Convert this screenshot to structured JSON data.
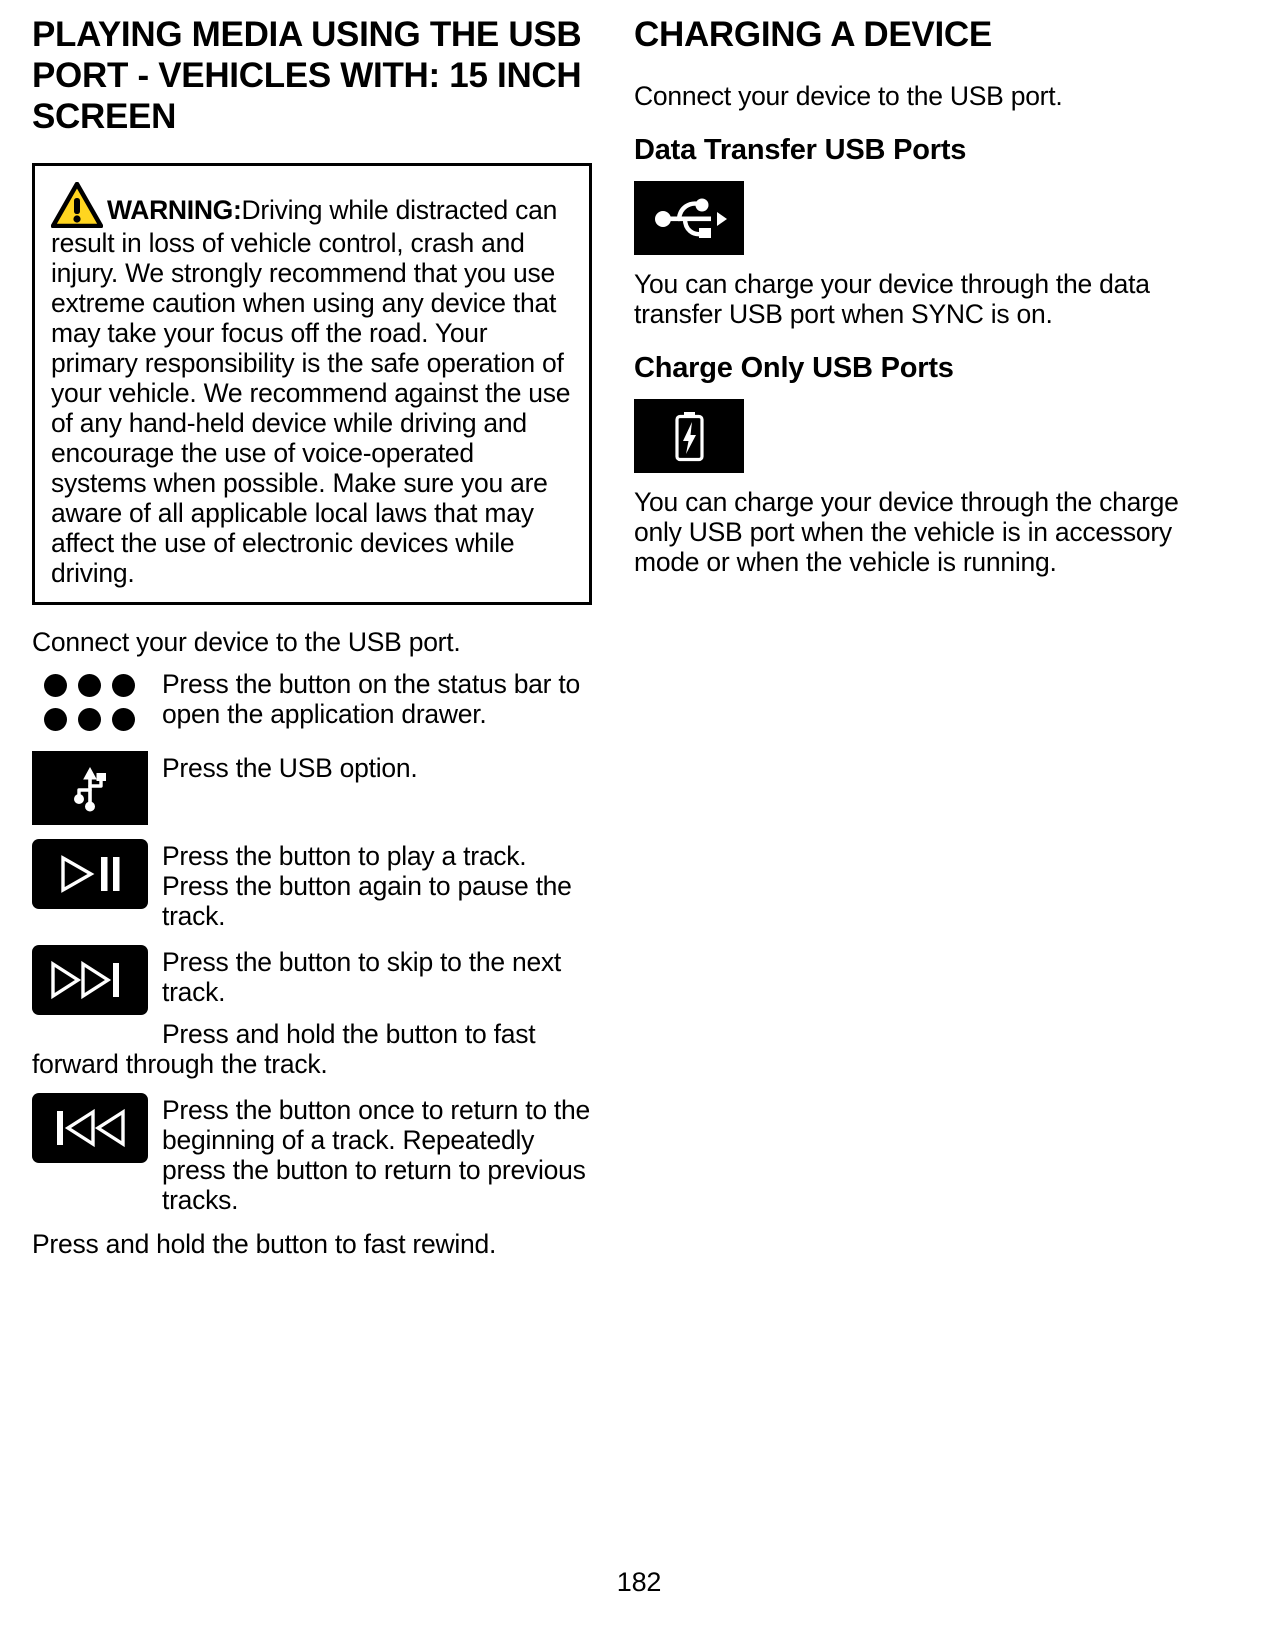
{
  "page": {
    "number": "182"
  },
  "left_column": {
    "title": "PLAYING MEDIA USING THE USB PORT - VEHICLES WITH: 15 INCH SCREEN",
    "warning": {
      "icon": "warning-triangle-icon",
      "label": "WARNING:",
      "text": "Driving while distracted can result in loss of vehicle control, crash and injury. We strongly recommend that you use extreme caution when using any device that may take your focus off the road. Your primary responsibility is the safe operation of your vehicle. We recommend against the use of any hand-held device while driving and encourage the use of voice-operated systems when possible. Make sure you are aware of all applicable local laws that may affect the use of electronic devices while driving."
    },
    "intro": "Connect your device to the USB port.",
    "steps": [
      {
        "icon": "app-drawer-dots-icon",
        "text": "Press the button on the status bar to open the application drawer."
      },
      {
        "icon": "usb-vertical-icon",
        "text": "Press the USB option."
      },
      {
        "icon": "play-pause-icon",
        "text": "Press the button to play a track. Press the button again to pause the track."
      },
      {
        "icon": "skip-next-icon",
        "text": "Press the button to skip to the next track.",
        "extra": "Press and hold the button to fast forward through the track."
      },
      {
        "icon": "skip-previous-icon",
        "text": "Press the button once to return to the beginning of a track. Repeatedly press the button to return to previous tracks.",
        "extra": "Press and hold the button to fast rewind."
      }
    ]
  },
  "right_column": {
    "title": "CHARGING A DEVICE",
    "intro": "Connect your device to the USB port.",
    "sections": [
      {
        "heading": "Data Transfer USB Ports",
        "icon": "usb-horizontal-icon",
        "text": "You can charge your device through the data transfer USB port when SYNC is on."
      },
      {
        "heading": "Charge Only USB Ports",
        "icon": "battery-charging-icon",
        "text": "You can charge your device through the charge only USB port when the vehicle is in accessory mode or when the vehicle is running."
      }
    ]
  },
  "colors": {
    "warning_yellow": "#FFD520",
    "ink": "#000000",
    "paper": "#FFFFFF"
  }
}
